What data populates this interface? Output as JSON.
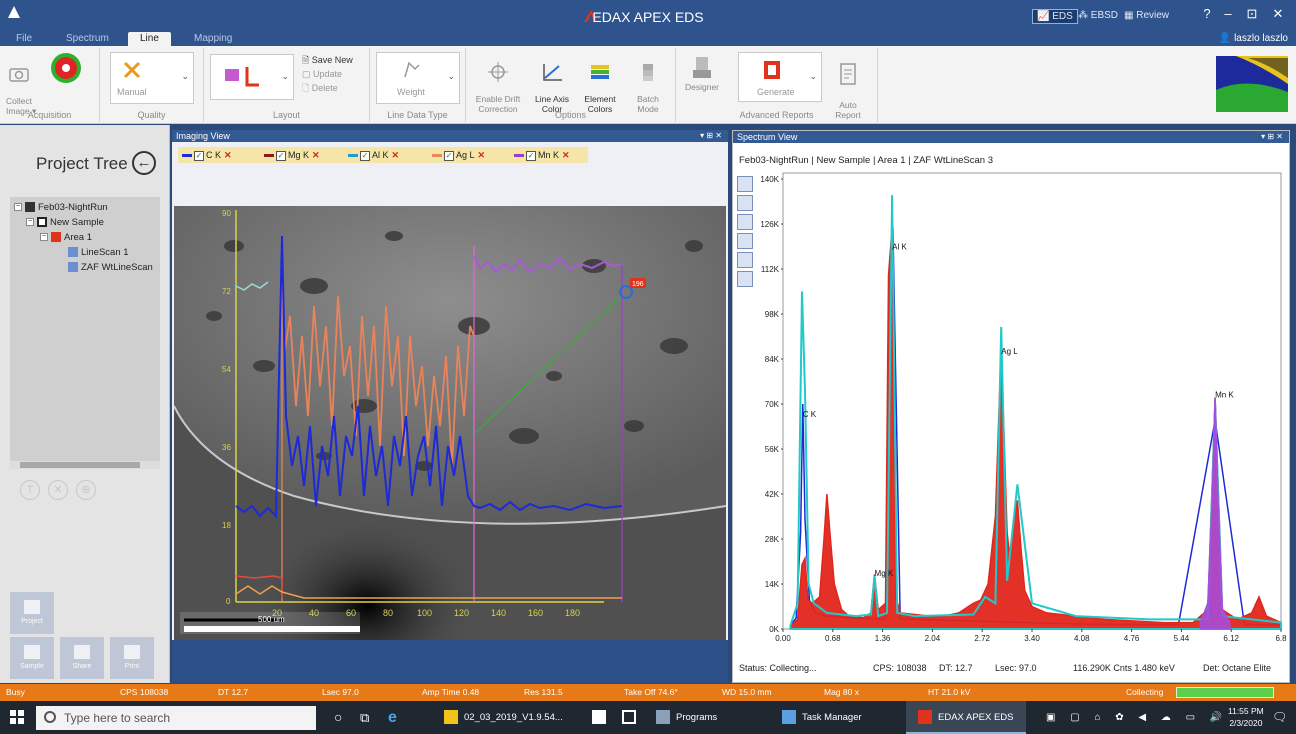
{
  "titlebar": {
    "app_title": "EDAX APEX EDS",
    "modes": [
      {
        "label": "EDS",
        "active": true
      },
      {
        "label": "EBSD",
        "active": false
      },
      {
        "label": "Review",
        "active": false
      }
    ],
    "user": "laszlo laszlo",
    "help": "?",
    "minimize": "–",
    "maximize": "⊡",
    "close": "✕"
  },
  "tabs": [
    {
      "label": "File",
      "active": false
    },
    {
      "label": "Spectrum",
      "active": false
    },
    {
      "label": "Line",
      "active": true
    },
    {
      "label": "Mapping",
      "active": false
    }
  ],
  "ribbon": {
    "acquisition": {
      "label": "Acquisition",
      "collect": "Collect\nImage ▾"
    },
    "quality": {
      "label": "Quality",
      "manual": "Manual"
    },
    "layout": {
      "label": "Layout",
      "save_new": "Save New",
      "update": "Update",
      "delete": "Delete"
    },
    "line_data_type": {
      "label": "Line Data Type",
      "weight": "Weight"
    },
    "options": {
      "label": "Options",
      "drift": "Enable Drift\nCorrection",
      "axis_color": "Line Axis\nColor",
      "element_colors": "Element\nColors",
      "batch": "Batch\nMode"
    },
    "advanced": {
      "label": "Advanced Reports",
      "designer": "Designer",
      "generate": "Generate",
      "auto": "Auto\nReport"
    }
  },
  "left": {
    "title": "Project Tree",
    "tree": [
      {
        "label": "Feb03-NightRun",
        "level": 0,
        "icon": "project-icon"
      },
      {
        "label": "New Sample",
        "level": 1,
        "icon": "sample-icon"
      },
      {
        "label": "Area 1",
        "level": 2,
        "icon": "area-icon"
      },
      {
        "label": "LineScan 1",
        "level": 3,
        "icon": "linescan-icon"
      },
      {
        "label": "ZAF WtLineScan",
        "level": 3,
        "icon": "linescan-icon"
      }
    ],
    "round_buttons": [
      "T",
      "✕",
      "⊕"
    ],
    "nav": [
      "Project",
      "Sample",
      "Share",
      "Print"
    ]
  },
  "imaging": {
    "title": "Imaging View",
    "controls": "▾ ⊞ ✕",
    "legend": [
      {
        "label": "C K",
        "color": "#1d2ad6"
      },
      {
        "label": "Mg K",
        "color": "#8a1c1c"
      },
      {
        "label": "Al K",
        "color": "#1aa0c8"
      },
      {
        "label": "Ag L",
        "color": "#e98a5c"
      },
      {
        "label": "Mn K",
        "color": "#9b3ec9"
      }
    ],
    "x_ticks": [
      "20",
      "40",
      "60",
      "80",
      "100",
      "120",
      "140",
      "160",
      "180"
    ],
    "y_ticks": [
      "90",
      "72",
      "54",
      "36",
      "18",
      "0"
    ],
    "scale_bar": "500 um",
    "marker": "196"
  },
  "spectrum": {
    "title": "Spectrum View",
    "controls": "▾ ⊞ ✕",
    "header": "Feb03-NightRun | New Sample | Area 1 | ZAF WtLineScan 3",
    "status": "Status: Collecting...",
    "cps": "CPS: 108038",
    "dt": "DT: 12.7",
    "lsec": "Lsec: 97.0",
    "cnts": "116.290K Cnts  1.480 keV",
    "det": "Det: Octane Elite"
  },
  "chart_data": {
    "type": "area",
    "title": "",
    "xlabel": "",
    "ylabel": "",
    "x_ticks": [
      "0.00",
      "0.68",
      "1.36",
      "2.04",
      "2.72",
      "3.40",
      "4.08",
      "4.76",
      "5.44",
      "6.12",
      "6.8"
    ],
    "y_ticks": [
      "0K",
      "14K",
      "28K",
      "42K",
      "56K",
      "70K",
      "84K",
      "98K",
      "112K",
      "126K",
      "140K"
    ],
    "xlim": [
      0,
      6.8
    ],
    "ylim": [
      0,
      140000
    ],
    "grid": false,
    "peak_labels": [
      {
        "label": "C K",
        "x": 0.27,
        "y": 66000
      },
      {
        "label": "Mg K",
        "x": 1.25,
        "y": 16500
      },
      {
        "label": "Al K",
        "x": 1.49,
        "y": 118000
      },
      {
        "label": "Ag L",
        "x": 2.98,
        "y": 85500
      },
      {
        "label": "Mn K",
        "x": 5.9,
        "y": 72000
      }
    ],
    "series": [
      {
        "name": "C K",
        "color": "#1d2ad6",
        "x": [
          0.1,
          0.18,
          0.24,
          0.27,
          0.3,
          0.36,
          0.44,
          0.6,
          1.0,
          1.4,
          1.5,
          1.6,
          2.2,
          3.0,
          3.6,
          4.2,
          4.8,
          5.4,
          5.9,
          6.3,
          6.8
        ],
        "y": [
          1000,
          3500,
          30000,
          70000,
          34000,
          9000,
          5000,
          4000,
          3300,
          3100,
          125000,
          3100,
          2700,
          2200,
          1800,
          1500,
          1400,
          1400,
          65000,
          1500,
          1200
        ]
      },
      {
        "name": "Ag L",
        "color": "#e2261c",
        "x": [
          0.1,
          0.2,
          0.26,
          0.3,
          0.34,
          0.4,
          0.5,
          0.56,
          0.6,
          0.64,
          0.7,
          0.8,
          0.9,
          1.1,
          1.2,
          1.25,
          1.3,
          1.4,
          1.44,
          1.49,
          1.54,
          1.6,
          1.8,
          2.0,
          2.2,
          2.4,
          2.6,
          2.7,
          2.8,
          2.9,
          2.98,
          3.06,
          3.1,
          3.15,
          3.2,
          3.25,
          3.3,
          3.4,
          3.6,
          3.8,
          4.0,
          4.4,
          4.8,
          5.2,
          5.6,
          5.8,
          5.9,
          6.0,
          6.2,
          6.4,
          6.5,
          6.6,
          6.8
        ],
        "y": [
          1000,
          3000,
          20000,
          22000,
          9000,
          8000,
          10000,
          28000,
          42000,
          30000,
          14000,
          6000,
          4000,
          3500,
          5000,
          17000,
          6000,
          8000,
          110000,
          125000,
          10000,
          5000,
          4500,
          4000,
          4000,
          5000,
          8000,
          9000,
          14000,
          35000,
          88000,
          30000,
          22000,
          34000,
          40000,
          25000,
          12000,
          7000,
          5000,
          4500,
          4000,
          3000,
          2500,
          2000,
          2000,
          6000,
          72000,
          6000,
          3000,
          5000,
          10000,
          4000,
          2000
        ]
      },
      {
        "name": "Al K",
        "color": "#23c8c8",
        "x": [
          0.1,
          0.2,
          0.26,
          0.3,
          0.35,
          0.42,
          0.6,
          1.0,
          1.2,
          1.25,
          1.3,
          1.42,
          1.49,
          1.56,
          1.8,
          2.6,
          2.76,
          2.9,
          2.98,
          3.06,
          3.2,
          3.4,
          4.0,
          5.0,
          5.8,
          5.9,
          6.0,
          6.4,
          6.8
        ],
        "y": [
          1000,
          8000,
          105000,
          74000,
          14000,
          8000,
          5000,
          4000,
          4500,
          16500,
          4000,
          5000,
          135000,
          5000,
          4000,
          4500,
          10000,
          8000,
          94000,
          15000,
          45000,
          8000,
          4000,
          3000,
          3000,
          70000,
          4000,
          3000,
          2000
        ]
      },
      {
        "name": "Mn K",
        "color": "#a44de0",
        "x": [
          5.7,
          5.8,
          5.86,
          5.9,
          5.94,
          6.0,
          6.1
        ],
        "y": [
          2000,
          8000,
          40000,
          72000,
          40000,
          6000,
          2000
        ]
      }
    ]
  },
  "statusbar": {
    "busy": "Busy",
    "cps": "CPS 108038",
    "dt": "DT 12.7",
    "lsec": "Lsec 97.0",
    "amp": "Amp Time 0.48",
    "res": "Res 131.5",
    "takeoff": "Take Off 74.6°",
    "wd": "WD 15.0 mm",
    "mag": "Mag 80 x",
    "ht": "HT 21.0 kV",
    "collecting": "Collecting"
  },
  "taskbar": {
    "search_placeholder": "Type here to search",
    "items": [
      "02_03_2019_V1.9.54...",
      "Programs",
      "Task Manager",
      "EDAX APEX EDS"
    ],
    "time": "11:55 PM",
    "date": "2/3/2020"
  }
}
